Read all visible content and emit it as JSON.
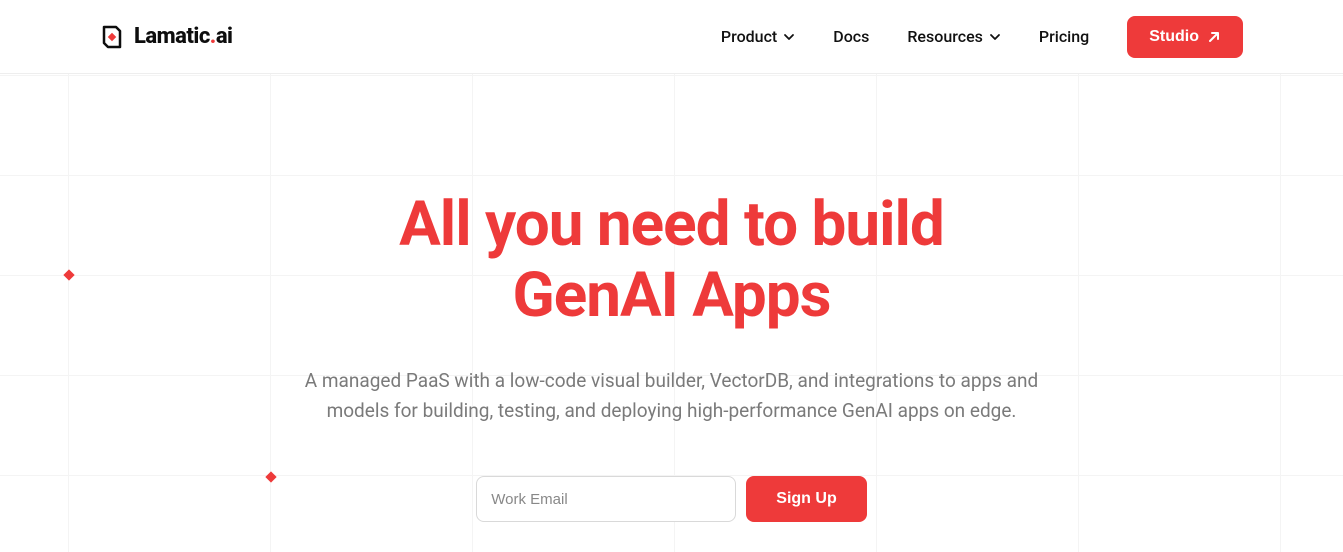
{
  "brand": {
    "name_left": "Lamatic",
    "name_right": "ai"
  },
  "nav": {
    "items": [
      {
        "label": "Product",
        "dropdown": true
      },
      {
        "label": "Docs",
        "dropdown": false
      },
      {
        "label": "Resources",
        "dropdown": true
      },
      {
        "label": "Pricing",
        "dropdown": false
      }
    ],
    "cta": "Studio"
  },
  "hero": {
    "title_line1": "All you need to build",
    "title_line2": "GenAI Apps",
    "subtitle": "A managed PaaS with a low-code visual builder, VectorDB, and integrations to apps and models for building, testing, and deploying high-performance GenAI apps on edge."
  },
  "signup": {
    "placeholder": "Work Email",
    "button": "Sign Up"
  },
  "colors": {
    "accent": "#ee3a3a"
  }
}
